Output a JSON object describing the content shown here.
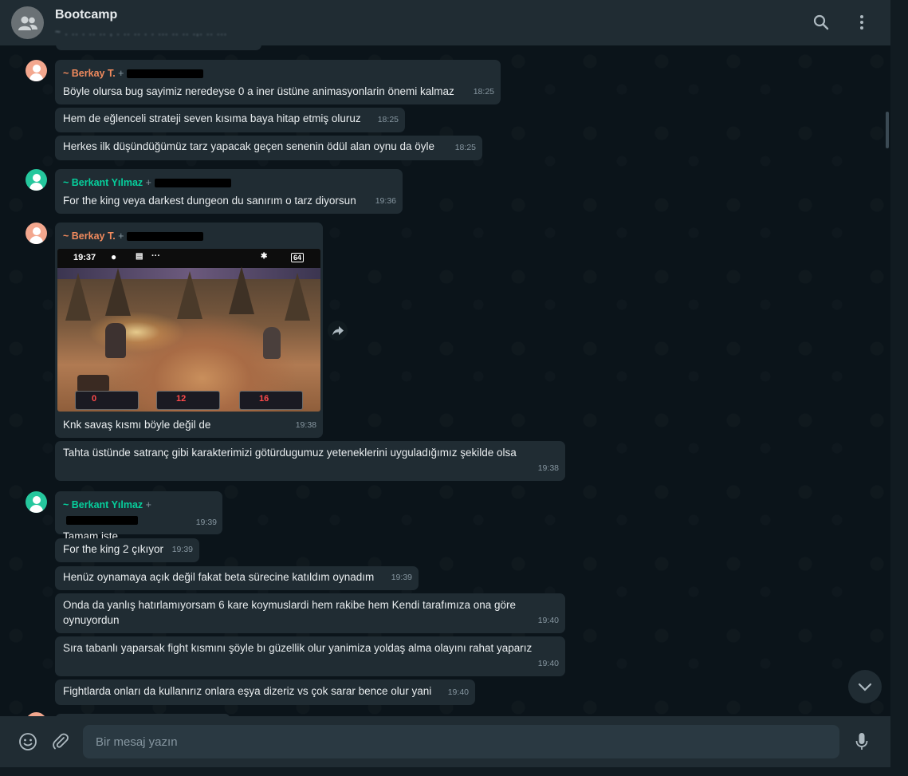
{
  "header": {
    "title": "Bootcamp",
    "subtitle": "~ . ..  . .. ..   , . .. .. .  . ... .. .. .,. .. ..."
  },
  "messages": [
    {
      "sender": "~ Berkay T.",
      "phone": "+",
      "text": "Böyle olursa bug sayimiz neredeyse 0 a iner üstüne animasyonlarin önemi kalmaz",
      "time": "18:25"
    },
    {
      "text": "Hem de eğlenceli strateji seven kısıma baya hitap etmiş oluruz",
      "time": "18:25"
    },
    {
      "text": "Herkes ilk düşündüğümüz tarz yapacak geçen senenin ödül alan oynu da öyle",
      "time": "18:25"
    },
    {
      "sender": "~ Berkant Yılmaz",
      "phone": "+",
      "text": "For the king veya darkest dungeon du sanırım o tarz diyorsun",
      "time": "19:36"
    },
    {
      "sender": "~ Berkay T.",
      "phone": "+",
      "text": "Knk savaş kısmı böyle değil de",
      "time": "19:38",
      "image": {
        "status_time": "19:37",
        "battery": "64",
        "hud_values": [
          "0",
          "12",
          "16"
        ]
      }
    },
    {
      "text": "Tahta üstünde satranç gibi karakterimizi götürdugumuz yeteneklerini uyguladığımız şekilde olsa",
      "time": "19:38"
    },
    {
      "sender": "~ Berkant Yılmaz",
      "phone": "+",
      "text": "Tamam işte",
      "time": "19:39"
    },
    {
      "text": "For the king 2 çıkıyor",
      "time": "19:39"
    },
    {
      "text": "Henüz oynamaya açık değil fakat beta sürecine katıldım oynadım",
      "time": "19:39"
    },
    {
      "text": "Onda da yanlış hatırlamıyorsam 6 kare koymuslardi hem rakibe hem Kendi tarafımıza ona göre oynuyordun",
      "time": "19:40"
    },
    {
      "text": "Sıra tabanlı yaparsak fight kısmını şöyle bı güzellik olur yanimiza yoldaş alma olayını rahat yaparız",
      "time": "19:40"
    },
    {
      "text": "Fightlarda onları da kullanırız onlara eşya dizeriz vs çok sarar bence olur yani",
      "time": "19:40"
    }
  ],
  "composer": {
    "placeholder": "Bir mesaj yazın"
  },
  "icons": [
    "group-avatar-icon",
    "search-icon",
    "menu-icon",
    "emoji-icon",
    "attach-icon",
    "mic-icon",
    "forward-icon",
    "chevron-down-icon"
  ],
  "colors": {
    "bubble": "#202c33",
    "berkay": "#f08a5d",
    "berkant": "#06cf9c",
    "background": "#0b141a"
  }
}
